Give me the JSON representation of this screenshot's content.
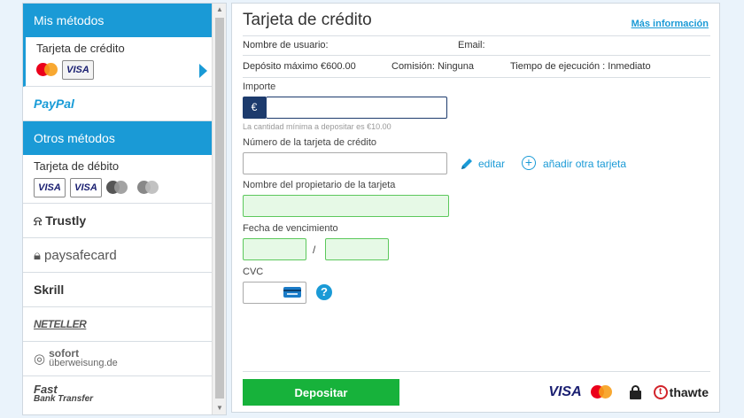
{
  "sidebar": {
    "my_methods_header": "Mis métodos",
    "selected_method": {
      "label": "Tarjeta de crédito",
      "card_brands": [
        "mastercard",
        "VISA"
      ]
    },
    "paypal": {
      "text_a": "Pay",
      "text_b": "Pal"
    },
    "other_methods_header": "Otros métodos",
    "debit": {
      "label": "Tarjeta de débito",
      "card_brands": [
        "VISA",
        "VISA",
        "maestro",
        "maestro"
      ]
    },
    "providers": [
      {
        "name": "Trustly",
        "icon": "trustly-icon"
      },
      {
        "name": "paysafecard",
        "icon": "lock-icon"
      },
      {
        "name": "Skrill",
        "icon": ""
      },
      {
        "name": "NETELLER",
        "icon": ""
      },
      {
        "name": "sofort",
        "subname": "überweisung.de",
        "icon": "sofort-icon"
      },
      {
        "name": "Fast",
        "subname": "Bank Transfer",
        "icon": "arrow-icon"
      }
    ]
  },
  "panel": {
    "title": "Tarjeta de crédito",
    "more_info": "Más información",
    "username_label": "Nombre de usuario:",
    "email_label": "Email:",
    "max_deposit": "Depósito máximo €600.00",
    "commission": "Comisión: Ninguna",
    "execution_time": "Tiempo de ejecución : Inmediato"
  },
  "form": {
    "amount": {
      "label": "Importe",
      "prefix": "€",
      "value": "",
      "hint": "La cantidad mínima a depositar es €10.00"
    },
    "card_number": {
      "label": "Número de la tarjeta de crédito",
      "value": "",
      "edit_label": "editar",
      "add_label": "añadir otra tarjeta"
    },
    "holder": {
      "label": "Nombre del propietario de la tarjeta",
      "value": ""
    },
    "expiry": {
      "label": "Fecha de vencimiento",
      "separator": "/",
      "month": "",
      "year": ""
    },
    "cvc": {
      "label": "CVC",
      "value": "",
      "help": "?"
    },
    "submit_label": "Depositar"
  },
  "footer": {
    "visa": "VISA",
    "thawte": "thawte",
    "thawte_mark": "t"
  },
  "colors": {
    "accent": "#1a9ad6",
    "submit": "#17b23b",
    "navy": "#1d3b6d"
  }
}
